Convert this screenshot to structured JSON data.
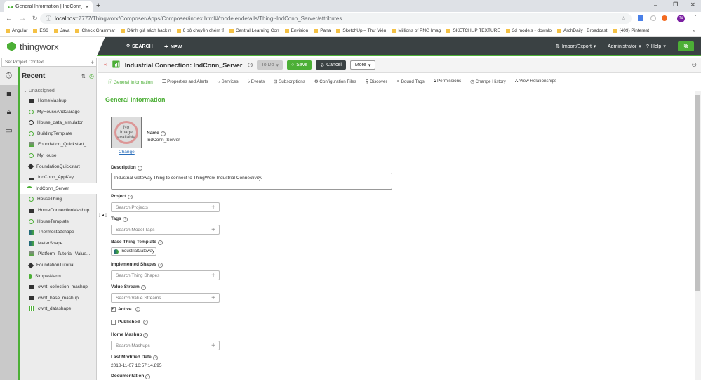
{
  "browser": {
    "tab_title": "General Information | IndConn_S",
    "url_host": "localhost",
    "url_rest": ":7777/Thingworx/Composer/Apps/Composer/index.html#/modeler/details/Thing~IndConn_Server/attributes",
    "profile": "Tú",
    "bookmarks": [
      "Angular",
      "ES6",
      "Java",
      "Check Grammar",
      "Đánh giá sách hack n",
      "6 bộ chuyên chém tỉ",
      "Central Learning Con",
      "Envision",
      "Pana",
      "SketchUp – Thư Viện",
      "Millions of PNG Imag",
      "SKETCHUP TEXTURE",
      "3d models - downlo",
      "ArchDaily | Broadcast",
      "(409) Pinterest"
    ],
    "more": "»"
  },
  "header": {
    "logo": "thingworx",
    "search": "SEARCH",
    "new": "NEW",
    "import_export": "Import/Export",
    "user": "Administrator",
    "help": "Help"
  },
  "sidebar": {
    "context_placeholder": "Set Project Context",
    "recent": "Recent",
    "group": "Unassigned",
    "items": [
      {
        "label": "HomeMashup",
        "icon": "mashup"
      },
      {
        "label": "MyHouseAndGarage",
        "icon": "thing"
      },
      {
        "label": "House_data_simulator",
        "icon": "timer"
      },
      {
        "label": "BuildingTemplate",
        "icon": "thing"
      },
      {
        "label": "Foundation_Quickstart_...",
        "icon": "value-stream"
      },
      {
        "label": "MyHouse",
        "icon": "thing"
      },
      {
        "label": "FoundationQuickstart",
        "icon": "tag"
      },
      {
        "label": "IndConn_AppKey",
        "icon": "key"
      },
      {
        "label": "IndConn_Server",
        "icon": "wifi",
        "selected": true
      },
      {
        "label": "HouseThing",
        "icon": "thing"
      },
      {
        "label": "HomeConnectionMashup",
        "icon": "mashup"
      },
      {
        "label": "HouseTemplate",
        "icon": "thing"
      },
      {
        "label": "ThermostatShape",
        "icon": "shape"
      },
      {
        "label": "MeterShape",
        "icon": "shape"
      },
      {
        "label": "Platform_Tutorial_Value...",
        "icon": "value-stream"
      },
      {
        "label": "FoundationTutorial",
        "icon": "tag"
      },
      {
        "label": "SimpleAlarm",
        "icon": "alarm"
      },
      {
        "label": "cwht_collection_mashup",
        "icon": "mashup"
      },
      {
        "label": "cwht_base_mashup",
        "icon": "mashup"
      },
      {
        "label": "cwht_datashape",
        "icon": "datashape"
      }
    ]
  },
  "entity": {
    "title": "Industrial Connection: IndConn_Server",
    "todo": "To Do",
    "save": "Save",
    "cancel": "Cancel",
    "more": "More"
  },
  "tabs": [
    "General Information",
    "Properties and Alerts",
    "Services",
    "Events",
    "Subscriptions",
    "Configuration Files",
    "Discover",
    "Bound Tags",
    "Permissions",
    "Change History",
    "View Relationships"
  ],
  "form": {
    "section": "General Information",
    "no_image": "No image available",
    "change": "Change",
    "name_label": "Name",
    "name_value": "IndConn_Server",
    "description_label": "Description",
    "description_value": "Industrial Gateway Thing to connect to ThingWorx Industrial Connectivity.",
    "project_label": "Project",
    "project_placeholder": "Search Projects",
    "tags_label": "Tags",
    "tags_placeholder": "Search Model Tags",
    "template_label": "Base Thing Template",
    "template_value": "IndustrialGateway",
    "shapes_label": "Implemented Shapes",
    "shapes_placeholder": "Search Thing Shapes",
    "stream_label": "Value Stream",
    "stream_placeholder": "Search Value Streams",
    "active_label": "Active",
    "active_checked": true,
    "published_label": "Published",
    "published_checked": false,
    "mashup_label": "Home Mashup",
    "mashup_placeholder": "Search Mashups",
    "modified_label": "Last Modified Date",
    "modified_value": "2018-11-07 16:57:14.895",
    "doc_label": "Documentation"
  },
  "colors": {
    "accent": "#4caf36",
    "header": "#3a4143"
  }
}
